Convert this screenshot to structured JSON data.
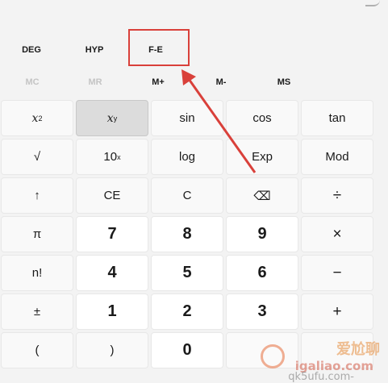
{
  "modes": {
    "deg": "DEG",
    "hyp": "HYP",
    "fe": "F-E"
  },
  "memory": {
    "mc": "MC",
    "mr": "MR",
    "mplus": "M+",
    "mminus": "M-",
    "ms": "MS"
  },
  "keys": {
    "row1": {
      "square_base": "x",
      "square_exp": "2",
      "power_base": "x",
      "power_exp": "y",
      "sin": "sin",
      "cos": "cos",
      "tan": "tan"
    },
    "row2": {
      "sqrt": "√",
      "ten_base": "10",
      "ten_exp": "x",
      "log": "log",
      "exp": "Exp",
      "mod": "Mod"
    },
    "row3": {
      "shift": "↑",
      "ce": "CE",
      "c": "C",
      "backspace": "⌫",
      "divide": "÷"
    },
    "row4": {
      "pi": "π",
      "seven": "7",
      "eight": "8",
      "nine": "9",
      "multiply": "×"
    },
    "row5": {
      "fact": "n!",
      "four": "4",
      "five": "5",
      "six": "6",
      "minus": "−"
    },
    "row6": {
      "negate": "±",
      "one": "1",
      "two": "2",
      "three": "3",
      "plus": "+"
    },
    "row7": {
      "lparen": "(",
      "rparen": ")",
      "zero": "0"
    }
  },
  "annotation": {
    "color": "#d9403a"
  },
  "watermark": {
    "brand": "爱尬聊",
    "line1": "igaliao.com",
    "line2": "qk5ufu.com-"
  }
}
